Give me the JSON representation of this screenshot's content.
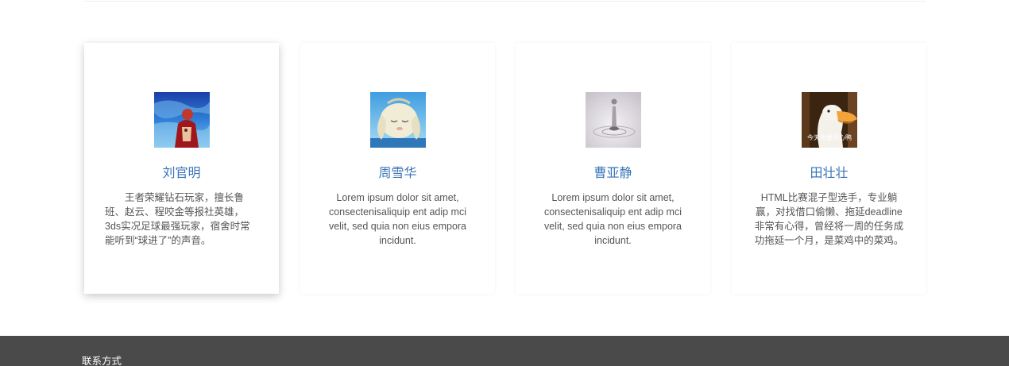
{
  "team": {
    "members": [
      {
        "name": "刘官明",
        "description": "王者荣耀钻石玩家，擅长鲁班、赵云、程咬金等报社英雄，3ds实况足球最强玩家，宿舍时常能听到“球进了”的声音。",
        "avatar": "warrior-sky-avatar"
      },
      {
        "name": "周雪华",
        "description": "Lorem ipsum dolor sit amet, consectenisaliquip ent adip mci velit, sed quia non eius empora incidunt.",
        "avatar": "cartoon-creature-avatar"
      },
      {
        "name": "曹亚静",
        "description": "Lorem ipsum dolor sit amet, consectenisaliquip ent adip mci velit, sed quia non eius empora incidunt.",
        "avatar": "water-drop-avatar"
      },
      {
        "name": "田壮壮",
        "description": "HTML比赛混子型选手，专业躺赢，对找借口偷懒、拖延deadline非常有心得，曾经将一周的任务成功拖延一个月，是菜鸡中的菜鸡。",
        "avatar": "duck-avatar",
        "avatar_caption": "今天也要开心鸭"
      }
    ]
  },
  "footer": {
    "title": "联系方式"
  },
  "colors": {
    "name_blue": "#3a74b8",
    "footer_bg": "#4a4a4a"
  }
}
